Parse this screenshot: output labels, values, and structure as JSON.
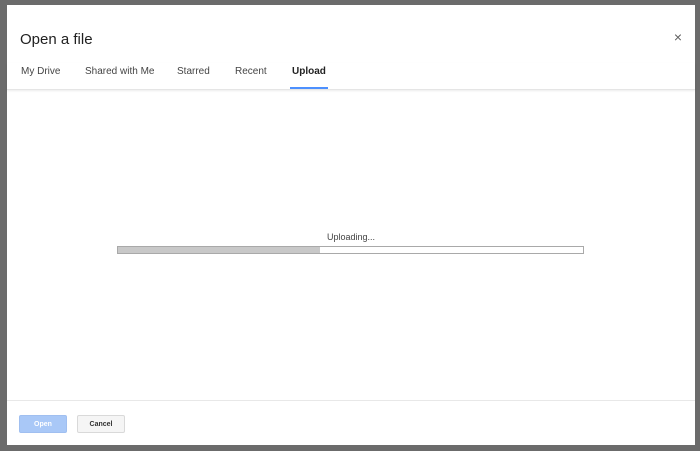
{
  "dialog": {
    "title": "Open a file",
    "close_icon": "×"
  },
  "tabs": [
    {
      "label": "My Drive",
      "active": false
    },
    {
      "label": "Shared with Me",
      "active": false
    },
    {
      "label": "Starred",
      "active": false
    },
    {
      "label": "Recent",
      "active": false
    },
    {
      "label": "Upload",
      "active": true
    }
  ],
  "upload": {
    "status": "Uploading...",
    "progress_fraction": 0.435
  },
  "footer": {
    "open_label": "Open",
    "cancel_label": "Cancel"
  },
  "colors": {
    "accent": "#4d90fe",
    "open_button_disabled": "#a9c8f7",
    "progress_fill": "#c8c8c8"
  },
  "icons": {
    "close": "close-icon"
  }
}
